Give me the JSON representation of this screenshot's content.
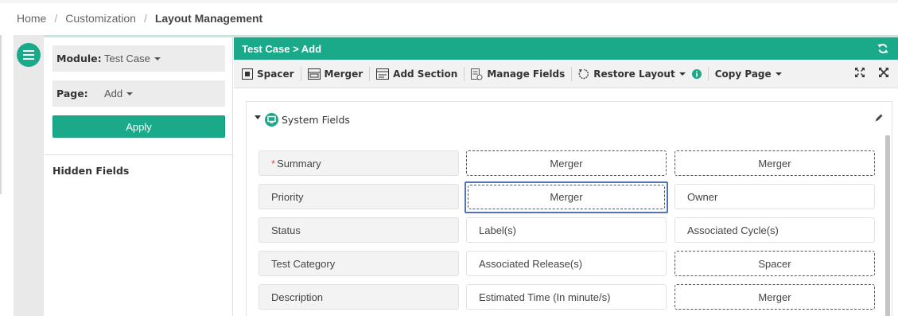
{
  "breadcrumb": {
    "items": [
      "Home",
      "Customization"
    ],
    "separator": "/",
    "current": "Layout Management"
  },
  "left_panel": {
    "module_label": "Module:",
    "module_value": "Test Case",
    "page_label": "Page:",
    "page_value": "Add",
    "apply_label": "Apply",
    "hidden_fields_title": "Hidden Fields"
  },
  "main": {
    "header_title": "Test Case > Add",
    "toolbar": {
      "spacer": "Spacer",
      "merger": "Merger",
      "add_section": "Add Section",
      "manage_fields": "Manage Fields",
      "restore_layout": "Restore Layout",
      "copy_page": "Copy Page"
    },
    "section_title": "System Fields",
    "fields": {
      "r1c1": "Summary",
      "r1c2": "Merger",
      "r1c3": "Merger",
      "r2c1": "Priority",
      "r2c2": "Merger",
      "r2c3": "Owner",
      "r3c1": "Status",
      "r3c2": "Label(s)",
      "r3c3": "Associated Cycle(s)",
      "r4c1": "Test Category",
      "r4c2": "Associated Release(s)",
      "r4c3": "Spacer",
      "r5c1": "Description",
      "r5c2": "Estimated Time (In minute/s)",
      "r5c3": "Merger"
    },
    "required_marker": "*"
  },
  "colors": {
    "accent": "#1aaa8a",
    "selection": "#4f73b5",
    "required": "#d9534f"
  },
  "icons": [
    "menu-icon",
    "refresh-icon",
    "spacer-icon",
    "merger-icon",
    "add-section-icon",
    "manage-fields-icon",
    "restore-icon",
    "info-icon",
    "expand-icon",
    "collapse-icon",
    "monitor-icon",
    "pencil-icon"
  ]
}
